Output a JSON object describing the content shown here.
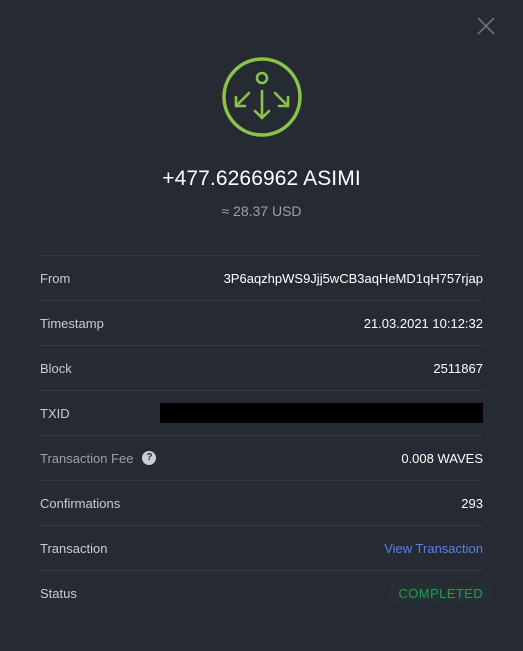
{
  "header": {
    "icon": "receive-tx-icon",
    "close_icon": "close-icon",
    "accent_color": "#8bc34a"
  },
  "summary": {
    "amount": "+477.6266962 ASIMI",
    "fiat": "≈ 28.37 USD"
  },
  "details": [
    {
      "label": "From",
      "value": "3P6aqzhpWS9Jjj5wCB3aqHeMD1qH757rjap"
    },
    {
      "label": "Timestamp",
      "value": "21.03.2021 10:12:32"
    },
    {
      "label": "Block",
      "value": "2511867"
    },
    {
      "label": "TXID",
      "value": ""
    },
    {
      "label": "Transaction Fee",
      "value": "0.008 WAVES",
      "help_icon": "question-icon"
    },
    {
      "label": "Confirmations",
      "value": "293"
    },
    {
      "label": "Transaction",
      "value": "View Transaction"
    },
    {
      "label": "Status",
      "value": "COMPLETED",
      "status_color": "#1f9c55"
    }
  ],
  "colors": {
    "background": "#262a33",
    "link": "#5a81ea"
  }
}
